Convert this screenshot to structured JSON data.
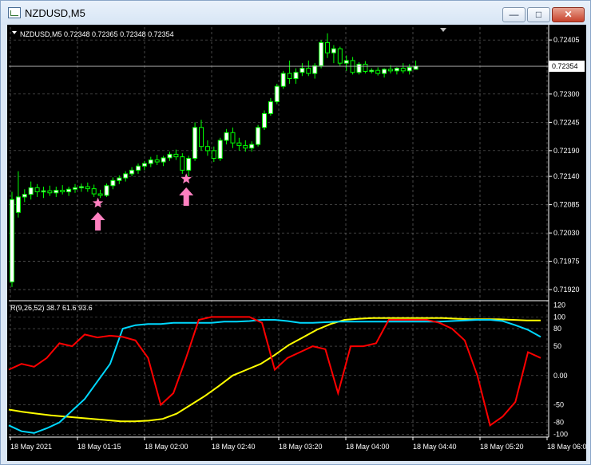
{
  "window": {
    "title": "NZDUSD,M5",
    "minimize_glyph": "—",
    "maximize_glyph": "□",
    "close_glyph": "✕"
  },
  "chart": {
    "info": "NZDUSD,M5  0.72348 0.72365 0.72348 0.72354",
    "current_price_label": "0.72354",
    "price_axis": [
      {
        "label": "0.72405",
        "value": 0.72405
      },
      {
        "label": "0.72300",
        "value": 0.723
      },
      {
        "label": "0.72245",
        "value": 0.72245
      },
      {
        "label": "0.72190",
        "value": 0.7219
      },
      {
        "label": "0.72140",
        "value": 0.7214
      },
      {
        "label": "0.72085",
        "value": 0.72085
      },
      {
        "label": "0.72030",
        "value": 0.7203
      },
      {
        "label": "0.71975",
        "value": 0.71975
      },
      {
        "label": "0.71920",
        "value": 0.7192
      }
    ],
    "indicator_label": "R(9,26,52) 38.7 61.6 93.6",
    "indicator_axis": [
      {
        "label": "120",
        "value": 120
      },
      {
        "label": "100",
        "value": 100
      },
      {
        "label": "80",
        "value": 80
      },
      {
        "label": "50",
        "value": 50
      },
      {
        "label": "0.00",
        "value": 0
      },
      {
        "label": "-50",
        "value": -50
      },
      {
        "label": "-80",
        "value": -80
      },
      {
        "label": "-100",
        "value": -100
      }
    ],
    "time_axis": [
      "18 May 2021",
      "18 May 01:15",
      "18 May 02:00",
      "18 May 02:40",
      "18 May 03:20",
      "18 May 04:00",
      "18 May 04:40",
      "18 May 05:20",
      "18 May 06:00"
    ],
    "colors": {
      "background": "#000000",
      "grid": "#c8c8c8",
      "bull_candle": "#ffffff",
      "bear_candle": "#000000",
      "candle_outline": "#00ff00",
      "signal": "#ff80c0",
      "series_fast": "#ff0000",
      "series_mid": "#00d8ff",
      "series_slow": "#ffff00",
      "text": "#ffffff"
    },
    "signals": [
      {
        "type": "star-icon",
        "time_index": 14,
        "price": 0.72088
      },
      {
        "type": "up-arrow-icon",
        "time_index": 14,
        "price": 0.72055
      },
      {
        "type": "star-icon",
        "time_index": 28,
        "price": 0.72135
      },
      {
        "type": "up-arrow-icon",
        "time_index": 28,
        "price": 0.72103
      }
    ],
    "candles": [
      {
        "o": 0.71935,
        "h": 0.7211,
        "l": 0.71925,
        "c": 0.72095
      },
      {
        "o": 0.7207,
        "h": 0.7215,
        "l": 0.7206,
        "c": 0.721
      },
      {
        "o": 0.721,
        "h": 0.72115,
        "l": 0.7209,
        "c": 0.72105
      },
      {
        "o": 0.72105,
        "h": 0.7213,
        "l": 0.72095,
        "c": 0.72118
      },
      {
        "o": 0.72118,
        "h": 0.72125,
        "l": 0.721,
        "c": 0.7211
      },
      {
        "o": 0.7211,
        "h": 0.7212,
        "l": 0.72098,
        "c": 0.72112
      },
      {
        "o": 0.72112,
        "h": 0.72122,
        "l": 0.72102,
        "c": 0.72108
      },
      {
        "o": 0.72108,
        "h": 0.7212,
        "l": 0.721,
        "c": 0.72113
      },
      {
        "o": 0.72113,
        "h": 0.72123,
        "l": 0.72105,
        "c": 0.7211
      },
      {
        "o": 0.7211,
        "h": 0.7212,
        "l": 0.72102,
        "c": 0.72115
      },
      {
        "o": 0.72115,
        "h": 0.72125,
        "l": 0.72108,
        "c": 0.72118
      },
      {
        "o": 0.72118,
        "h": 0.72126,
        "l": 0.7211,
        "c": 0.7212
      },
      {
        "o": 0.7212,
        "h": 0.72128,
        "l": 0.7211,
        "c": 0.72116
      },
      {
        "o": 0.72116,
        "h": 0.72124,
        "l": 0.721,
        "c": 0.72106
      },
      {
        "o": 0.72106,
        "h": 0.72114,
        "l": 0.72098,
        "c": 0.72103
      },
      {
        "o": 0.72103,
        "h": 0.72126,
        "l": 0.721,
        "c": 0.72122
      },
      {
        "o": 0.72122,
        "h": 0.72138,
        "l": 0.72115,
        "c": 0.72132
      },
      {
        "o": 0.72132,
        "h": 0.72142,
        "l": 0.72125,
        "c": 0.72137
      },
      {
        "o": 0.72137,
        "h": 0.7215,
        "l": 0.7213,
        "c": 0.72145
      },
      {
        "o": 0.72145,
        "h": 0.72158,
        "l": 0.7214,
        "c": 0.72152
      },
      {
        "o": 0.72152,
        "h": 0.72165,
        "l": 0.72145,
        "c": 0.7216
      },
      {
        "o": 0.7216,
        "h": 0.7217,
        "l": 0.72152,
        "c": 0.72165
      },
      {
        "o": 0.72165,
        "h": 0.72178,
        "l": 0.72158,
        "c": 0.72172
      },
      {
        "o": 0.72172,
        "h": 0.72182,
        "l": 0.72162,
        "c": 0.72168
      },
      {
        "o": 0.72168,
        "h": 0.7218,
        "l": 0.7216,
        "c": 0.72176
      },
      {
        "o": 0.72176,
        "h": 0.72188,
        "l": 0.7217,
        "c": 0.72183
      },
      {
        "o": 0.72183,
        "h": 0.72192,
        "l": 0.72172,
        "c": 0.72178
      },
      {
        "o": 0.72178,
        "h": 0.72185,
        "l": 0.72145,
        "c": 0.72152
      },
      {
        "o": 0.72152,
        "h": 0.7218,
        "l": 0.7214,
        "c": 0.72175
      },
      {
        "o": 0.72175,
        "h": 0.72245,
        "l": 0.7217,
        "c": 0.72235
      },
      {
        "o": 0.72235,
        "h": 0.7225,
        "l": 0.7219,
        "c": 0.72198
      },
      {
        "o": 0.72198,
        "h": 0.7221,
        "l": 0.7218,
        "c": 0.7219
      },
      {
        "o": 0.7219,
        "h": 0.72198,
        "l": 0.72168,
        "c": 0.72175
      },
      {
        "o": 0.72175,
        "h": 0.72215,
        "l": 0.7217,
        "c": 0.7221
      },
      {
        "o": 0.7221,
        "h": 0.72232,
        "l": 0.72202,
        "c": 0.72225
      },
      {
        "o": 0.72225,
        "h": 0.72235,
        "l": 0.72195,
        "c": 0.72205
      },
      {
        "o": 0.72205,
        "h": 0.72215,
        "l": 0.7219,
        "c": 0.722
      },
      {
        "o": 0.722,
        "h": 0.7221,
        "l": 0.72188,
        "c": 0.72195
      },
      {
        "o": 0.72195,
        "h": 0.72208,
        "l": 0.72188,
        "c": 0.72202
      },
      {
        "o": 0.72202,
        "h": 0.7224,
        "l": 0.72198,
        "c": 0.72235
      },
      {
        "o": 0.72235,
        "h": 0.72268,
        "l": 0.7223,
        "c": 0.72262
      },
      {
        "o": 0.72262,
        "h": 0.72292,
        "l": 0.72258,
        "c": 0.72285
      },
      {
        "o": 0.72285,
        "h": 0.7232,
        "l": 0.7228,
        "c": 0.72315
      },
      {
        "o": 0.72315,
        "h": 0.72345,
        "l": 0.7231,
        "c": 0.7234
      },
      {
        "o": 0.7234,
        "h": 0.72365,
        "l": 0.7232,
        "c": 0.7233
      },
      {
        "o": 0.7233,
        "h": 0.7235,
        "l": 0.7232,
        "c": 0.72342
      },
      {
        "o": 0.72342,
        "h": 0.7236,
        "l": 0.72335,
        "c": 0.7235
      },
      {
        "o": 0.7235,
        "h": 0.72365,
        "l": 0.72335,
        "c": 0.7234
      },
      {
        "o": 0.7234,
        "h": 0.7236,
        "l": 0.7233,
        "c": 0.72355
      },
      {
        "o": 0.72355,
        "h": 0.72405,
        "l": 0.7235,
        "c": 0.724
      },
      {
        "o": 0.724,
        "h": 0.72418,
        "l": 0.7237,
        "c": 0.7238
      },
      {
        "o": 0.7238,
        "h": 0.72395,
        "l": 0.7236,
        "c": 0.72388
      },
      {
        "o": 0.72388,
        "h": 0.72392,
        "l": 0.72355,
        "c": 0.7236
      },
      {
        "o": 0.7236,
        "h": 0.72375,
        "l": 0.72345,
        "c": 0.72365
      },
      {
        "o": 0.72365,
        "h": 0.72372,
        "l": 0.72338,
        "c": 0.72342
      },
      {
        "o": 0.72342,
        "h": 0.72362,
        "l": 0.72338,
        "c": 0.72358
      },
      {
        "o": 0.72358,
        "h": 0.72364,
        "l": 0.7234,
        "c": 0.72344
      },
      {
        "o": 0.72344,
        "h": 0.7235,
        "l": 0.7234,
        "c": 0.72346
      },
      {
        "o": 0.72346,
        "h": 0.72352,
        "l": 0.72336,
        "c": 0.7234
      },
      {
        "o": 0.7234,
        "h": 0.7235,
        "l": 0.72332,
        "c": 0.72348
      },
      {
        "o": 0.72348,
        "h": 0.72356,
        "l": 0.7234,
        "c": 0.72345
      },
      {
        "o": 0.72345,
        "h": 0.72352,
        "l": 0.72338,
        "c": 0.7235
      },
      {
        "o": 0.7235,
        "h": 0.7236,
        "l": 0.7234,
        "c": 0.72345
      },
      {
        "o": 0.72345,
        "h": 0.72358,
        "l": 0.72338,
        "c": 0.72352
      },
      {
        "o": 0.72348,
        "h": 0.72365,
        "l": 0.72348,
        "c": 0.72354
      }
    ],
    "rsi_fast": [
      10,
      20,
      15,
      30,
      55,
      50,
      70,
      65,
      68,
      66,
      60,
      30,
      -50,
      -30,
      30,
      95,
      100,
      100,
      100,
      100,
      90,
      10,
      30,
      40,
      50,
      45,
      -30,
      50,
      50,
      55,
      95,
      95,
      95,
      95,
      90,
      80,
      60,
      0,
      -85,
      -70,
      -45,
      40,
      30
    ],
    "rsi_mid": [
      -85,
      -95,
      -98,
      -90,
      -80,
      -60,
      -40,
      -10,
      20,
      80,
      86,
      88,
      88,
      90,
      90,
      90,
      90,
      92,
      92,
      93,
      95,
      95,
      93,
      90,
      90,
      91,
      92,
      92,
      92,
      92,
      92,
      92,
      92,
      92,
      92,
      93,
      94,
      95,
      95,
      93,
      86,
      78,
      66
    ],
    "rsi_slow": [
      -58,
      -62,
      -65,
      -68,
      -70,
      -72,
      -74,
      -76,
      -78,
      -78,
      -77,
      -74,
      -65,
      -50,
      -35,
      -18,
      0,
      10,
      20,
      35,
      52,
      65,
      78,
      88,
      95,
      97,
      98,
      98,
      98,
      98,
      98,
      98,
      97,
      96,
      96,
      96,
      95,
      94,
      94
    ]
  }
}
